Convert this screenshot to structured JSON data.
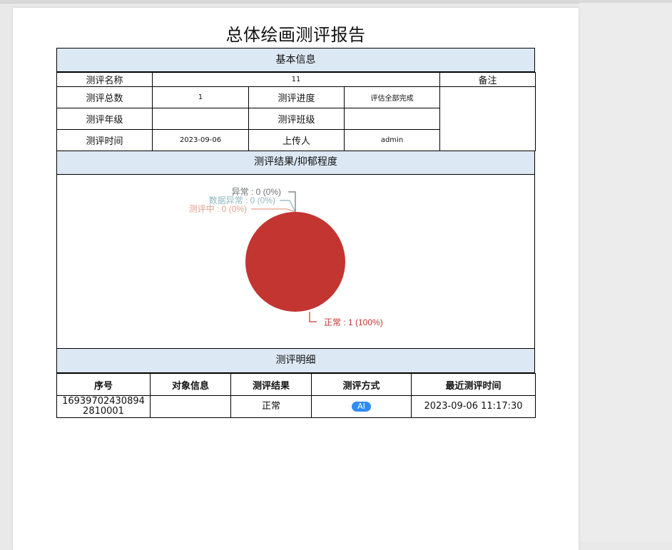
{
  "report": {
    "title": "总体绘画测评报告"
  },
  "basic_info": {
    "header": "基本信息",
    "name_label": "测评名称",
    "name_value": "11",
    "remark_label": "备注",
    "total_label": "测评总数",
    "total_value": "1",
    "progress_label": "测评进度",
    "progress_value": "评估全部完成",
    "grade_label": "测评年级",
    "grade_value": "",
    "class_label": "测评班级",
    "class_value": "",
    "time_label": "测评时间",
    "time_value": "2023-09-06",
    "uploader_label": "上传人",
    "uploader_value": "admin"
  },
  "result_section": {
    "header": "测评结果/抑郁程度"
  },
  "chart_data": {
    "type": "pie",
    "slices": [
      {
        "label": "正常 : 1 (100%)",
        "value": 1,
        "color": "#c23531"
      },
      {
        "label": "测评中 : 0 (0%)",
        "value": 0,
        "color": "#e5a08b"
      },
      {
        "label": "数据异常 : 0 (0%)",
        "value": 0,
        "color": "#8fb7c3"
      },
      {
        "label": "异常 : 0 (0%)",
        "value": 0,
        "color": "#6e7074"
      }
    ]
  },
  "detail": {
    "header": "测评明细",
    "columns": [
      "序号",
      "对象信息",
      "测评结果",
      "测评方式",
      "最近测评时间"
    ],
    "rows": [
      {
        "id_line1": "16939702430894",
        "id_line2": "2810001",
        "object": "",
        "result": "正常",
        "method": "AI",
        "time": "2023-09-06 11:17:30"
      }
    ]
  }
}
